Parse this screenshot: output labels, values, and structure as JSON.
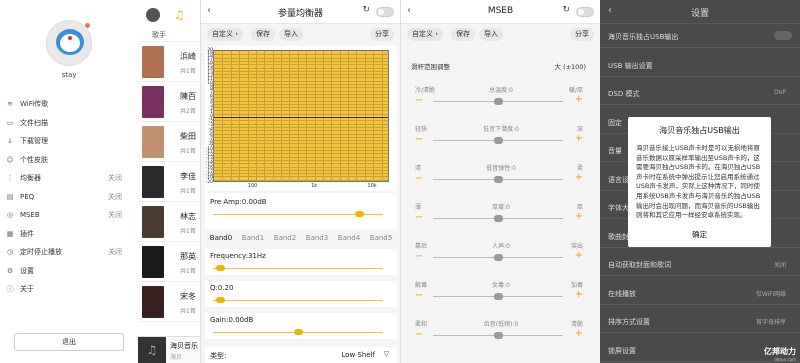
{
  "sidebar": {
    "username": "stay",
    "items": [
      {
        "label": "WiFi传歌",
        "status": "",
        "icon": "wifi-icon"
      },
      {
        "label": "文件扫描",
        "status": "",
        "icon": "file-scan-icon"
      },
      {
        "label": "下载管理",
        "status": "",
        "icon": "download-icon"
      },
      {
        "label": "个性皮肤",
        "status": "",
        "icon": "skin-icon"
      },
      {
        "label": "均衡器",
        "status": "关闭",
        "icon": "equalizer-icon"
      },
      {
        "label": "PEQ",
        "status": "关闭",
        "icon": "peq-icon"
      },
      {
        "label": "MSEB",
        "status": "关闭",
        "icon": "mseb-icon"
      },
      {
        "label": "插件",
        "status": "",
        "icon": "plugin-icon"
      },
      {
        "label": "定时停止播放",
        "status": "关闭",
        "icon": "timer-icon"
      },
      {
        "label": "设置",
        "status": "",
        "icon": "settings-icon"
      },
      {
        "label": "关于",
        "status": "",
        "icon": "about-icon"
      }
    ],
    "logout_label": "退出"
  },
  "songlist": {
    "tab_label": "歌手",
    "songs": [
      {
        "title": "浜崎",
        "sub": "共1首",
        "color": "#b07050"
      },
      {
        "title": "陳百",
        "sub": "共2首",
        "color": "#7a3060"
      },
      {
        "title": "柴田",
        "sub": "共1首",
        "color": "#c09070"
      },
      {
        "title": "李佳",
        "sub": "共1首",
        "color": "#2a2a2a"
      },
      {
        "title": "林志",
        "sub": "共1首",
        "color": "#4a3a30"
      },
      {
        "title": "那英",
        "sub": "共1首",
        "color": "#1a1a1a"
      },
      {
        "title": "宋冬",
        "sub": "共1首",
        "color": "#3a2020"
      }
    ],
    "player_title": "海贝音乐",
    "player_sub": "海贝"
  },
  "eq": {
    "title": "参量均衡器",
    "preset_label": "自定义",
    "save_label": "保存",
    "import_label": "导入",
    "share_label": "分享",
    "y_ticks": [
      "20",
      "19",
      "18",
      "17",
      "16",
      "15",
      "14",
      "13",
      "12",
      "11",
      "10",
      "9",
      "8",
      "7",
      "6",
      "5",
      "4",
      "3",
      "2",
      "1",
      "0",
      "-1",
      "-2",
      "-3",
      "-4",
      "-5",
      "-6",
      "-7",
      "-8",
      "-9",
      "-10",
      "-11",
      "-12",
      "-13",
      "-14",
      "-15",
      "-16",
      "-17",
      "-18",
      "-19",
      "-20"
    ],
    "x_ticks": [
      "100",
      "1k",
      "10k"
    ],
    "preamp_label": "Pre Amp:0.00dB",
    "preamp_level": 0.86,
    "bands": [
      "Band0",
      "Band1",
      "Band2",
      "Band3",
      "Band4",
      "Band5"
    ],
    "frequency_label": "Frequency:31Hz",
    "frequency_level": 0.04,
    "q_label": "Q:0.20",
    "q_level": 0.04,
    "gain_label": "Gain:0.00dB",
    "gain_level": 0.5,
    "type_label": "类型:",
    "type_value": "Low Shelf"
  },
  "mseb": {
    "title": "MSEB",
    "preset_label": "自定义",
    "save_label": "保存",
    "import_label": "导入",
    "share_label": "分享",
    "range_label": "滑杆范围调整",
    "range_value": "大 (±100)",
    "rows": [
      {
        "left": "冷/清脆",
        "center": "总温度:0",
        "right": "暖/厚"
      },
      {
        "left": "轻快",
        "center": "低音下潜度:0",
        "right": "深"
      },
      {
        "left": "清",
        "center": "低音弹性:0",
        "right": "柔"
      },
      {
        "left": "薄",
        "center": "厚度:0",
        "right": "厚"
      },
      {
        "left": "靠后",
        "center": "人声:0",
        "right": "突出"
      },
      {
        "left": "解毒",
        "center": "女毒:0",
        "right": "加毒"
      },
      {
        "left": "柔和",
        "center": "齿音(低频):0",
        "right": "清脆"
      }
    ]
  },
  "settings": {
    "title": "设置",
    "rows": [
      {
        "label": "海贝音乐独占USB输出",
        "value": ""
      },
      {
        "label": "USB 输出设置",
        "value": ""
      },
      {
        "label": "DSD 模式",
        "value": "DoP"
      },
      {
        "label": "固定",
        "value": ""
      },
      {
        "label": "音量",
        "value": ""
      },
      {
        "label": "语言设",
        "value": ""
      },
      {
        "label": "字体大",
        "value": ""
      },
      {
        "label": "歌曲封",
        "value": ""
      },
      {
        "label": "自动获取封面和歌词",
        "value": "关闭"
      },
      {
        "label": "在线播放",
        "value": "仅WiFi网络"
      },
      {
        "label": "排序方式设置",
        "value": "首字母排序"
      },
      {
        "label": "锁屏设置",
        "value": "使用"
      }
    ],
    "dialog": {
      "title": "海贝音乐独占USB输出",
      "body": "海贝音乐接上USB声卡时是可以无损地将原音乐数据以原采样率输出至USB声卡的，这需要海贝独占USB声卡的。在海贝独占USB声卡时在系统中弹出提示让您启用系统通过USB声卡发声，实际上这种情况下，同时使用系统USB声卡发声与海贝音乐的独占USB输出时会出现问题，而海贝音乐的USB输出则将和其它应用一样经安卓系统实现。",
      "ok_label": "确定"
    },
    "watermark": "亿邦动力",
    "watermark_sub": "ebrun.com"
  }
}
